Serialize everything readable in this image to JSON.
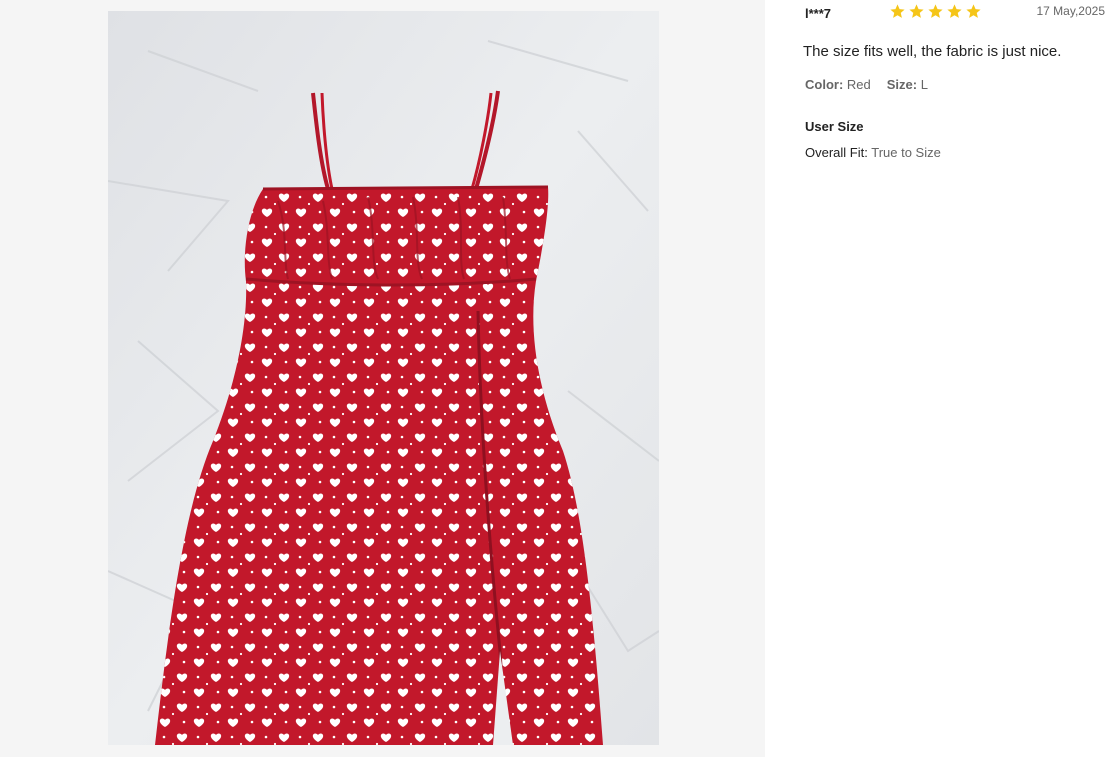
{
  "review": {
    "username": "l***7",
    "rating": 5,
    "date": "17 May,2025",
    "text": "The size fits well, the fabric is just nice.",
    "attributes": [
      {
        "label": "Color:",
        "value": "Red"
      },
      {
        "label": "Size:",
        "value": "L"
      }
    ],
    "user_size_title": "User Size",
    "fit_label": "Overall Fit:",
    "fit_value": "True to Size"
  },
  "photo": {
    "subject": "red heart-print slip dress on white sheet",
    "dress_color": "#c2182b",
    "print_color": "#ffffff",
    "background_color": "#e7e8ea"
  },
  "colors": {
    "star": "#f5c518",
    "text_dark": "#222222",
    "text_muted": "#666666"
  }
}
